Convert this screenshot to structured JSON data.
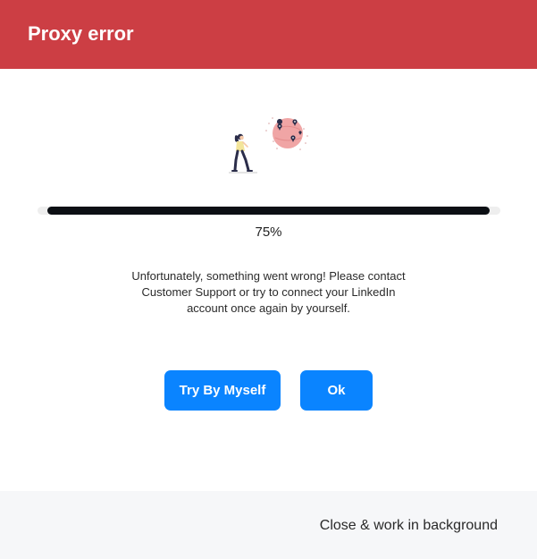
{
  "header": {
    "title": "Proxy error",
    "background_color": "#cc3e44"
  },
  "illustration": {
    "name": "person-walking-globe-illustration",
    "globe_color": "#f0a5a5",
    "figure_shirt_color": "#f3e59a"
  },
  "progress": {
    "value_percent": 75,
    "label": "75%",
    "fill_color": "#0c0f14",
    "track_color": "#eeeeee"
  },
  "message": {
    "lines": [
      "Unfortunately, something went wrong! Please contact",
      "Customer Support or try to connect your LinkedIn",
      "account once again by yourself."
    ]
  },
  "buttons": {
    "try_label": "Try By Myself",
    "ok_label": "Ok",
    "color": "#0a84ff"
  },
  "footer": {
    "close_label": "Close & work in background",
    "background_color": "#f6f7f9"
  }
}
